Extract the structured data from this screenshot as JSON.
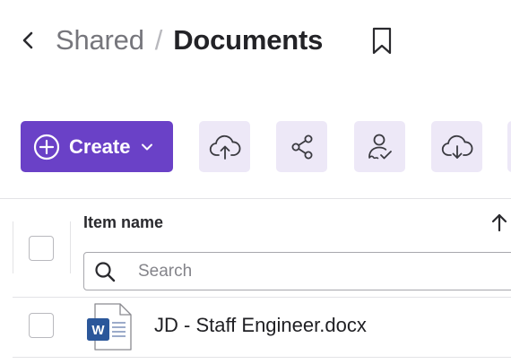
{
  "header": {
    "breadcrumb_parent": "Shared",
    "breadcrumb_separator": "/",
    "breadcrumb_current": "Documents"
  },
  "toolbar": {
    "create_label": "Create",
    "icons": [
      "upload-cloud-icon",
      "share-icon",
      "sign-icon",
      "download-cloud-icon"
    ]
  },
  "table": {
    "column_header": "Item name",
    "search_placeholder": "Search",
    "search_value": "",
    "rows": [
      {
        "name": "JD - Staff Engineer.docx",
        "type": "word-document"
      }
    ]
  },
  "colors": {
    "primary": "#6a41c7",
    "tool_bg": "#ede8f7",
    "word_blue": "#2b579a"
  }
}
